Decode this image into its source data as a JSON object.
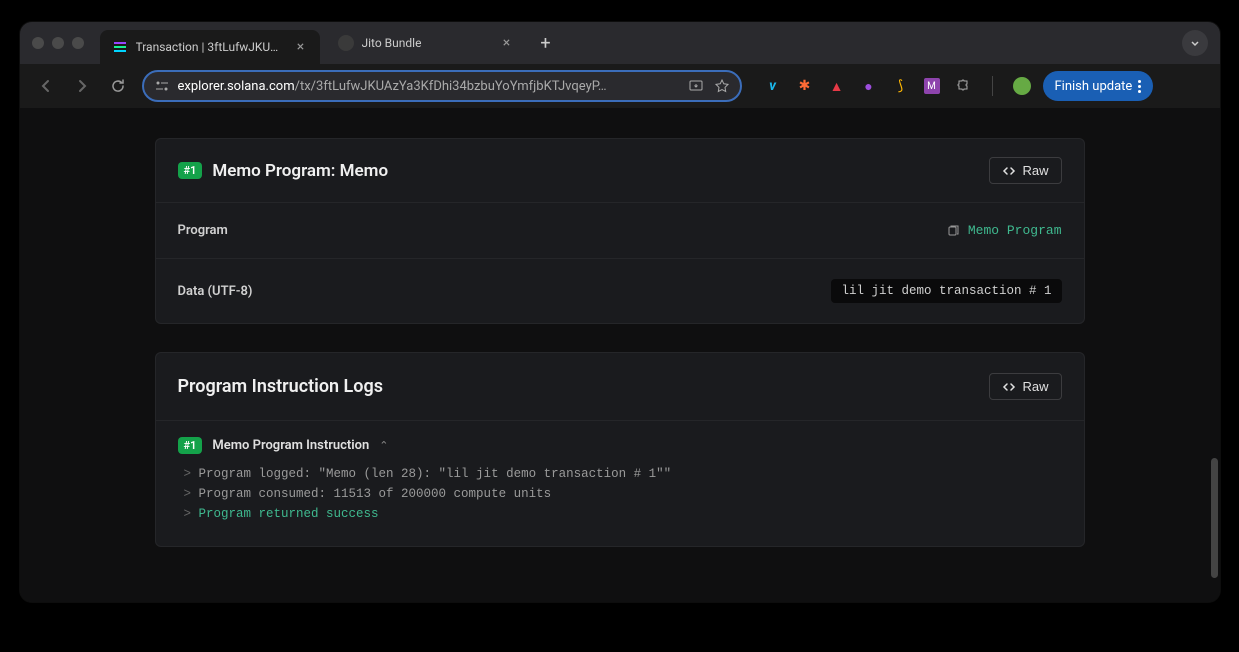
{
  "tabs": [
    {
      "title": "Transaction | 3ftLufwJKUAzY…",
      "active": true
    },
    {
      "title": "Jito Bundle",
      "active": false
    }
  ],
  "url": {
    "domain": "explorer.solana.com",
    "path": "/tx/3ftLufwJKUAzYa3KfDhi34bzbuYoYmfjbKTJvqeyP…"
  },
  "update_button": "Finish update",
  "instruction_card": {
    "badge": "#1",
    "title": "Memo Program: Memo",
    "raw_label": "Raw",
    "rows": {
      "program": {
        "label": "Program",
        "value": "Memo Program"
      },
      "data": {
        "label": "Data (UTF-8)",
        "value": "lil jit demo transaction # 1"
      }
    }
  },
  "logs_card": {
    "title": "Program Instruction Logs",
    "raw_label": "Raw",
    "entry": {
      "badge": "#1",
      "header": "Memo Program Instruction",
      "lines": [
        "Program logged: \"Memo (len 28): \"lil jit demo transaction # 1\"\"",
        "Program consumed: 11513 of 200000 compute units",
        "Program returned success"
      ]
    }
  }
}
